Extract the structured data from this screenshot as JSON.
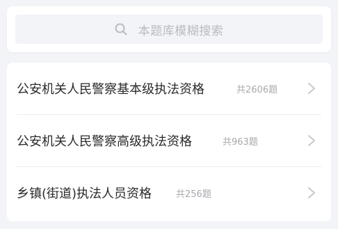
{
  "search": {
    "placeholder": "本题库模糊搜索"
  },
  "items": [
    {
      "title": "公安机关人民警察基本级执法资格",
      "count": "共2606题"
    },
    {
      "title": "公安机关人民警察高级执法资格",
      "count": "共963题"
    },
    {
      "title": "乡镇(街道)执法人员资格",
      "count": "共256题"
    }
  ],
  "colors": {
    "page_background": "#f3f4f8",
    "card_background": "#ffffff",
    "title_text": "#2a2a2a",
    "muted_text": "#a8a8ad",
    "chevron": "#c8c8cc"
  },
  "icons": {
    "search": "search-icon",
    "chevron": "chevron-right-icon"
  }
}
